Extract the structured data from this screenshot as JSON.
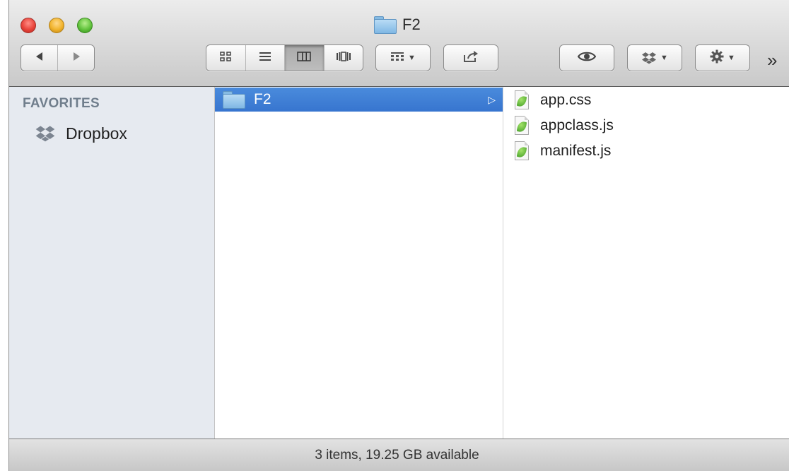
{
  "window": {
    "title": "F2",
    "title_icon": "folder-icon"
  },
  "toolbar": {
    "back_icon": "back-arrow-icon",
    "forward_icon": "forward-arrow-icon",
    "views": [
      {
        "name": "icon-view",
        "icon": "grid-icon",
        "active": false
      },
      {
        "name": "list-view",
        "icon": "list-icon",
        "active": false
      },
      {
        "name": "column-view",
        "icon": "columns-icon",
        "active": true
      },
      {
        "name": "coverflow-view",
        "icon": "coverflow-icon",
        "active": false
      }
    ],
    "arrange_icon": "arrange-icon",
    "share_icon": "share-icon",
    "quicklook_icon": "eye-icon",
    "dropbox_icon": "dropbox-icon",
    "action_icon": "gear-icon",
    "overflow_glyph": "»"
  },
  "sidebar": {
    "header": "FAVORITES",
    "items": [
      {
        "label": "Dropbox",
        "icon": "dropbox-icon"
      }
    ]
  },
  "columns": [
    {
      "items": [
        {
          "label": "F2",
          "icon": "folder-icon",
          "selected": true,
          "disclosure": "▷"
        }
      ]
    },
    {
      "items": [
        {
          "label": "app.css",
          "icon": "file-icon"
        },
        {
          "label": "appclass.js",
          "icon": "file-icon"
        },
        {
          "label": "manifest.js",
          "icon": "file-icon"
        }
      ]
    }
  ],
  "statusbar": {
    "text": "3 items, 19.25 GB available"
  },
  "colors": {
    "selection": "#3b7bd4",
    "sidebar_bg": "#e6eaf0",
    "sidebar_header": "#707e8c"
  }
}
